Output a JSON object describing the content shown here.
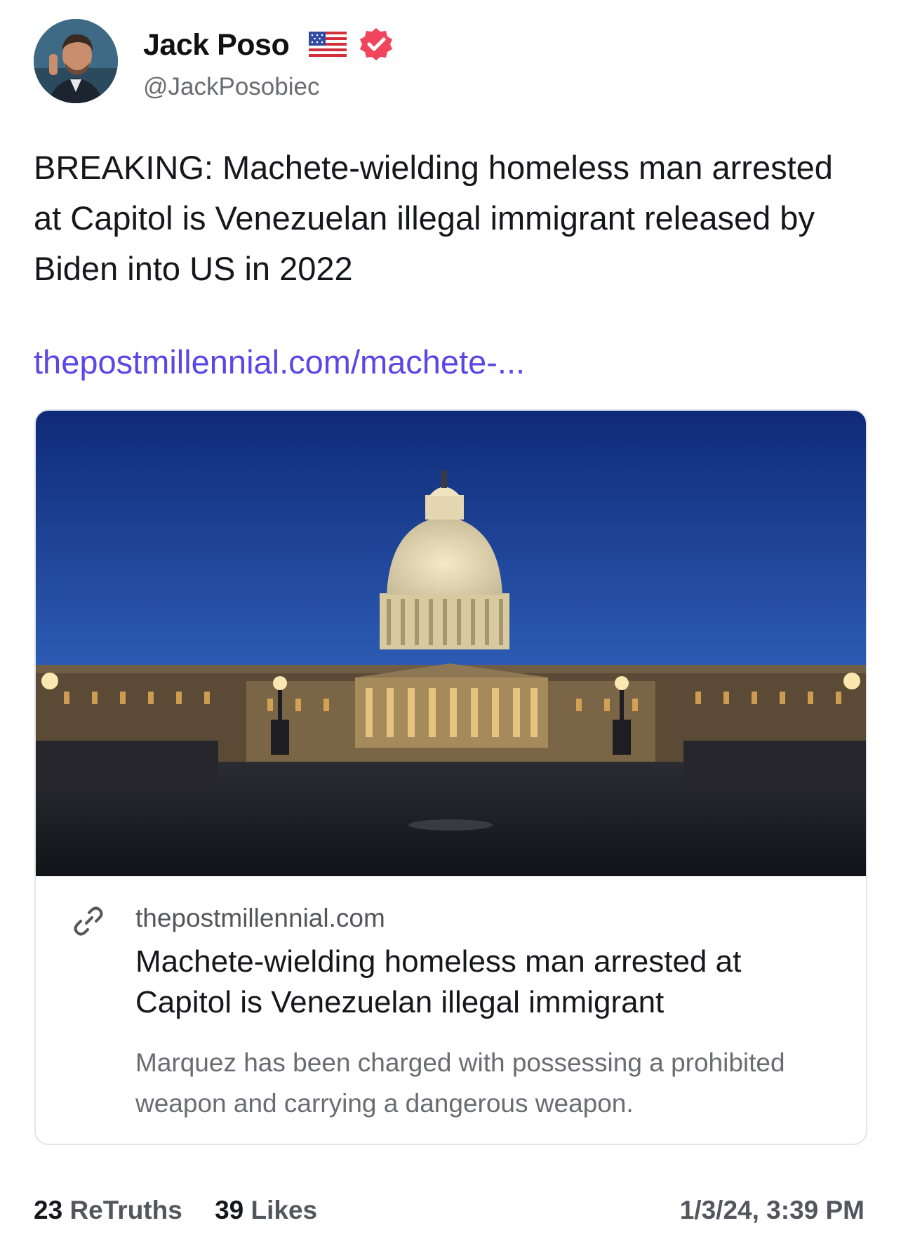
{
  "author": {
    "display_name": "Jack Poso",
    "handle": "@JackPosobiec",
    "badge_icons": [
      "us-flag-emoji",
      "verified-badge-icon"
    ],
    "verified_color": "#f0455d"
  },
  "post": {
    "text": "BREAKING: Machete-wielding homeless man arrested at Capitol is Venezuelan illegal immigrant released by Biden into US in 2022",
    "link_text": "thepostmillennial.com/machete-...",
    "link_color": "#5a47e6"
  },
  "link_card": {
    "image_description_icon": "capitol-photo",
    "domain": "thepostmillennial.com",
    "title": "Machete-wielding homeless man arrested at Capitol is Venezuelan illegal immigrant",
    "description": "Marquez has been charged with possessing a prohibited weapon and carrying a dangerous weapon."
  },
  "stats": {
    "retruths_count": "23",
    "retruths_label": "ReTruths",
    "likes_count": "39",
    "likes_label": "Likes",
    "timestamp": "1/3/24, 3:39 PM"
  }
}
